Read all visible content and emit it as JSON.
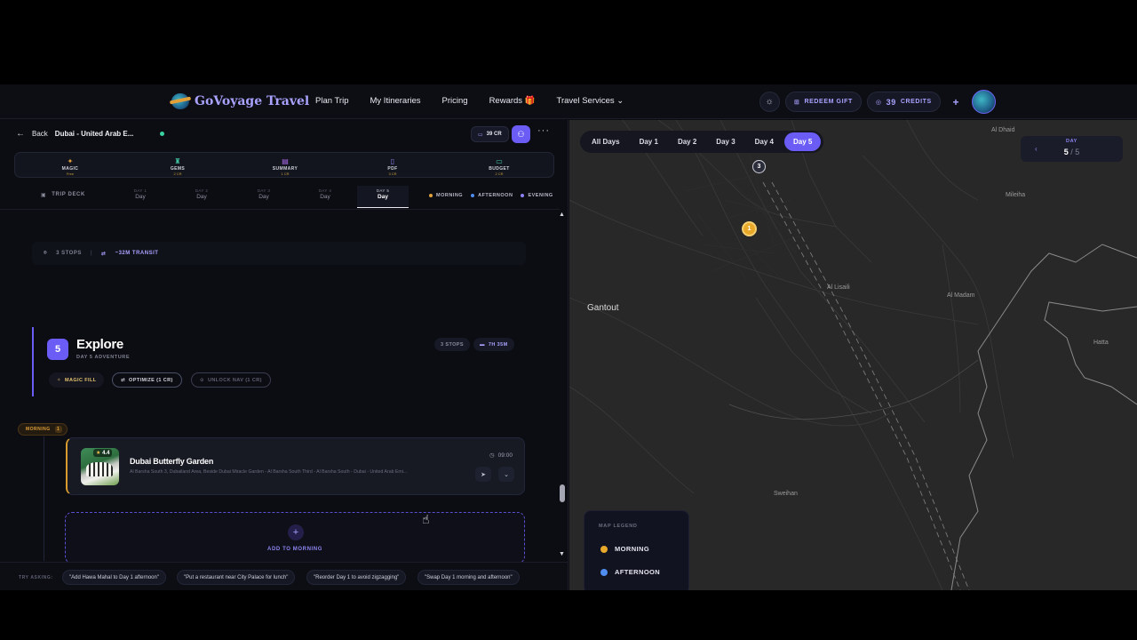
{
  "nav": {
    "brand": "GoVoyage Travel",
    "links": [
      "Plan Trip",
      "My Itineraries",
      "Pricing",
      "Rewards 🎁",
      "Travel Services ⌄"
    ],
    "redeem": "REDEEM GIFT",
    "credits_value": "39",
    "credits_label": "CREDITS",
    "add": "+"
  },
  "left": {
    "back": "Back",
    "trip": "Dubai - United Arab E...",
    "cr": "39 CR",
    "more": "···",
    "tools": [
      {
        "name": "MAGIC",
        "sub": "Free",
        "icon": "✦",
        "color": "#e0a13a"
      },
      {
        "name": "GEMS",
        "sub": "2 CR",
        "icon": "♜",
        "color": "#3fc6a0"
      },
      {
        "name": "SUMMARY",
        "sub": "1 CR",
        "icon": "▤",
        "color": "#b06bf0"
      },
      {
        "name": "PDF",
        "sub": "3 CR",
        "icon": "▯",
        "color": "#8c83f2"
      },
      {
        "name": "BUDGET",
        "sub": "2 CR",
        "icon": "▭",
        "color": "#3fc6a0"
      }
    ],
    "trip_deck": "TRIP DECK",
    "day_tabs": [
      {
        "k": "DAY 1",
        "v": "Day"
      },
      {
        "k": "DAY 2",
        "v": "Day"
      },
      {
        "k": "DAY 3",
        "v": "Day"
      },
      {
        "k": "DAY 4",
        "v": "Day"
      },
      {
        "k": "DAY 5",
        "v": "Day"
      }
    ],
    "slots": [
      {
        "label": "MORNING",
        "color": "#e0a13a"
      },
      {
        "label": "AFTERNOON",
        "color": "#4f8df0"
      },
      {
        "label": "EVENING",
        "color": "#8c83f2"
      }
    ],
    "stats": {
      "stops": "3 STOPS",
      "transit": "~32M TRANSIT"
    },
    "day": {
      "number": "5",
      "title": "Explore",
      "subtitle": "DAY 5 ADVENTURE",
      "stops": "3 STOPS",
      "duration": "7H 35M",
      "magic_fill": "MAGIC FILL",
      "optimize": "OPTIMIZE (1 CR)",
      "unlock_nav": "UNLOCK NAV (1 CR)"
    },
    "morning_chip": {
      "label": "MORNING",
      "count": "1"
    },
    "place": {
      "name": "Dubai Butterfly Garden",
      "rating": "4.4",
      "address": "Al Barsha South 3, Dubailand Area, Beside Dubai Miracle Garden - Al Barsha South Third - Al Barsha South - Dubai - United Arab Emi...",
      "time": "09:00"
    },
    "add_label": "ADD TO MORNING",
    "try_asking": "TRY ASKING:",
    "suggestions": [
      "\"Add Hawa Mahal to Day 1 afternoon\"",
      "\"Put a restaurant near City Palace for lunch\"",
      "\"Reorder Day 1 to avoid zigzagging\"",
      "\"Swap Day 1 morning and afternoon\""
    ]
  },
  "map": {
    "tabs": [
      "All Days",
      "Day 1",
      "Day 2",
      "Day 3",
      "Day 4",
      "Day 5"
    ],
    "active_tab": "Day 5",
    "day_nav": {
      "label": "DAY",
      "current": "5",
      "total": "5"
    },
    "places": [
      "Al Dhaid",
      "Mileiha",
      "Gantout",
      "Al Lisaili",
      "Al Madam",
      "Hatta",
      "Sweihan"
    ],
    "markers": [
      {
        "label": "3",
        "color": "#2b2d3a"
      },
      {
        "label": "1",
        "color": "#e8a92a"
      }
    ],
    "legend": {
      "title": "MAP LEGEND",
      "items": [
        {
          "label": "MORNING",
          "color": "#e8a92a"
        },
        {
          "label": "AFTERNOON",
          "color": "#4f8df0"
        }
      ]
    }
  }
}
